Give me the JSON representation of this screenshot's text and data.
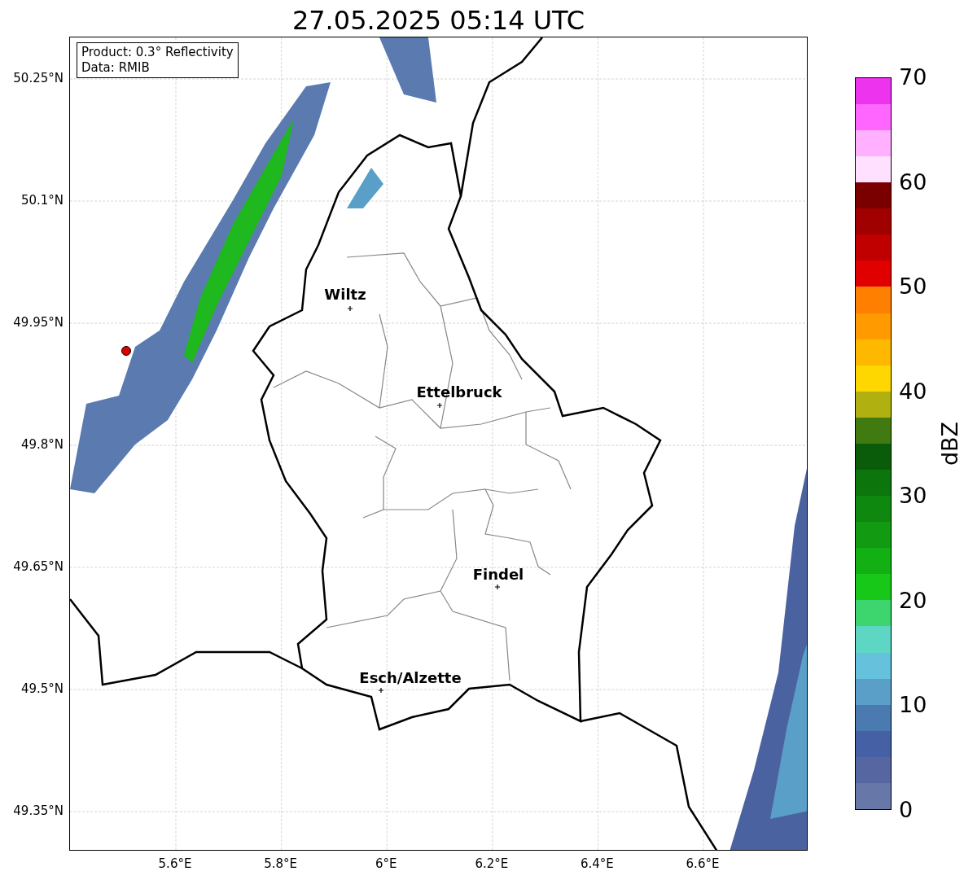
{
  "title": "27.05.2025 05:14 UTC",
  "info_box": [
    "Product: 0.3° Reflectivity",
    "Data: RMIB"
  ],
  "y_ticks": [
    "50.25°N",
    "50.1°N",
    "49.95°N",
    "49.8°N",
    "49.65°N",
    "49.5°N",
    "49.35°N"
  ],
  "x_ticks": [
    "5.6°E",
    "5.8°E",
    "6°E",
    "6.2°E",
    "6.4°E",
    "6.6°E"
  ],
  "cities": [
    {
      "name": "Wiltz"
    },
    {
      "name": "Ettelbruck"
    },
    {
      "name": "Findel"
    },
    {
      "name": "Esch/Alzette"
    }
  ],
  "colorbar": {
    "label": "dBZ",
    "ticks": [
      "70",
      "60",
      "50",
      "40",
      "30",
      "20",
      "10",
      "0"
    ],
    "bins": [
      {
        "color": "#6677a8"
      },
      {
        "color": "#5566a0"
      },
      {
        "color": "#4560a4"
      },
      {
        "color": "#4a7ab0"
      },
      {
        "color": "#5a9fc8"
      },
      {
        "color": "#66c2dc"
      },
      {
        "color": "#5ed6c4"
      },
      {
        "color": "#3dd66e"
      },
      {
        "color": "#18c818"
      },
      {
        "color": "#12b012"
      },
      {
        "color": "#129a12"
      },
      {
        "color": "#0f880f"
      },
      {
        "color": "#0c750c"
      },
      {
        "color": "#0a5c0a"
      },
      {
        "color": "#407a10"
      },
      {
        "color": "#b0b010"
      },
      {
        "color": "#ffd700"
      },
      {
        "color": "#ffb800"
      },
      {
        "color": "#ff9a00"
      },
      {
        "color": "#ff7f00"
      },
      {
        "color": "#e00000"
      },
      {
        "color": "#c00000"
      },
      {
        "color": "#a00000"
      },
      {
        "color": "#7a0000"
      },
      {
        "color": "#ffe0ff"
      },
      {
        "color": "#ffb0ff"
      },
      {
        "color": "#ff66ff"
      },
      {
        "color": "#ee33ee"
      }
    ]
  }
}
